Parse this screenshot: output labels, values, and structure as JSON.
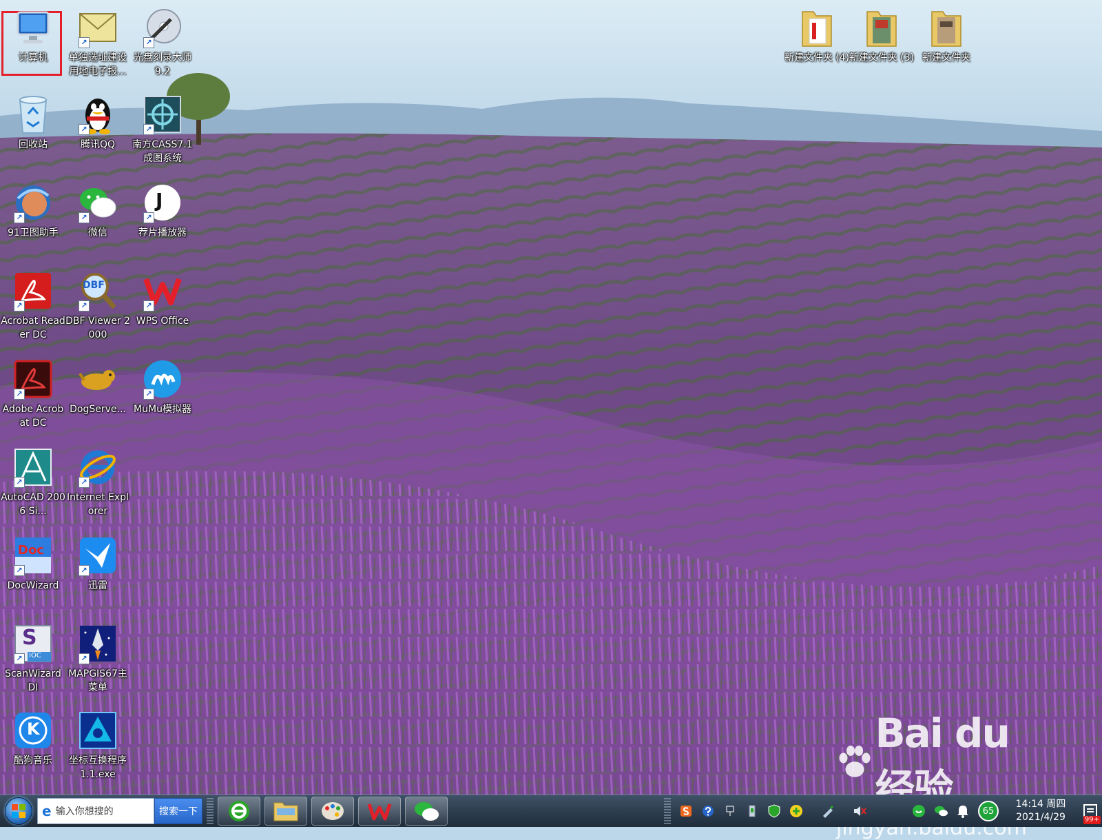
{
  "desktop": {
    "icons": [
      {
        "label": "计算机"
      },
      {
        "label": "单独选址建设用地电子报..."
      },
      {
        "label": "光盘刻录大师9.2"
      },
      {
        "label": "回收站"
      },
      {
        "label": "腾讯QQ"
      },
      {
        "label": "南方CASS7.1成图系统"
      },
      {
        "label": "91卫图助手"
      },
      {
        "label": "微信"
      },
      {
        "label": "荐片播放器"
      },
      {
        "label": "Acrobat Reader DC"
      },
      {
        "label": "DBF Viewer 2000"
      },
      {
        "label": "WPS Office"
      },
      {
        "label": "Adobe Acrobat DC"
      },
      {
        "label": "DogServe..."
      },
      {
        "label": "MuMu模拟器"
      },
      {
        "label": "AutoCAD 2006 Si..."
      },
      {
        "label": "Internet Explorer"
      },
      {
        "label": "DocWizard"
      },
      {
        "label": "迅雷"
      },
      {
        "label": "ScanWizard DI"
      },
      {
        "label": "MAPGIS67主菜单"
      },
      {
        "label": "酷狗音乐"
      },
      {
        "label": "坐标互换程序1.1.exe"
      },
      {
        "label": "新建文件夹 (4)"
      },
      {
        "label": "新建文件夹 (3)"
      },
      {
        "label": "新建文件夹"
      }
    ],
    "icon_glyphs": {
      "dbf": "DBF",
      "doc": "Doc",
      "scan_s": "S",
      "scan_sub": "IOC",
      "kugou": "K",
      "jianpian": "J"
    }
  },
  "watermark": {
    "brand": "Bai du 经验",
    "url": "jingyan.baidu.com"
  },
  "taskbar": {
    "search_placeholder": "输入你想搜的",
    "search_button": "搜索一下",
    "tray_qq_number": "65",
    "clock_time": "14:14 周四",
    "clock_date": "2021/4/29",
    "notifications_badge": "99+"
  },
  "colors": {
    "selection": "#e3202a",
    "taskbar": "#2a3a4d",
    "sky": "#bcd7ea",
    "lavender": "#7a4a8a"
  }
}
